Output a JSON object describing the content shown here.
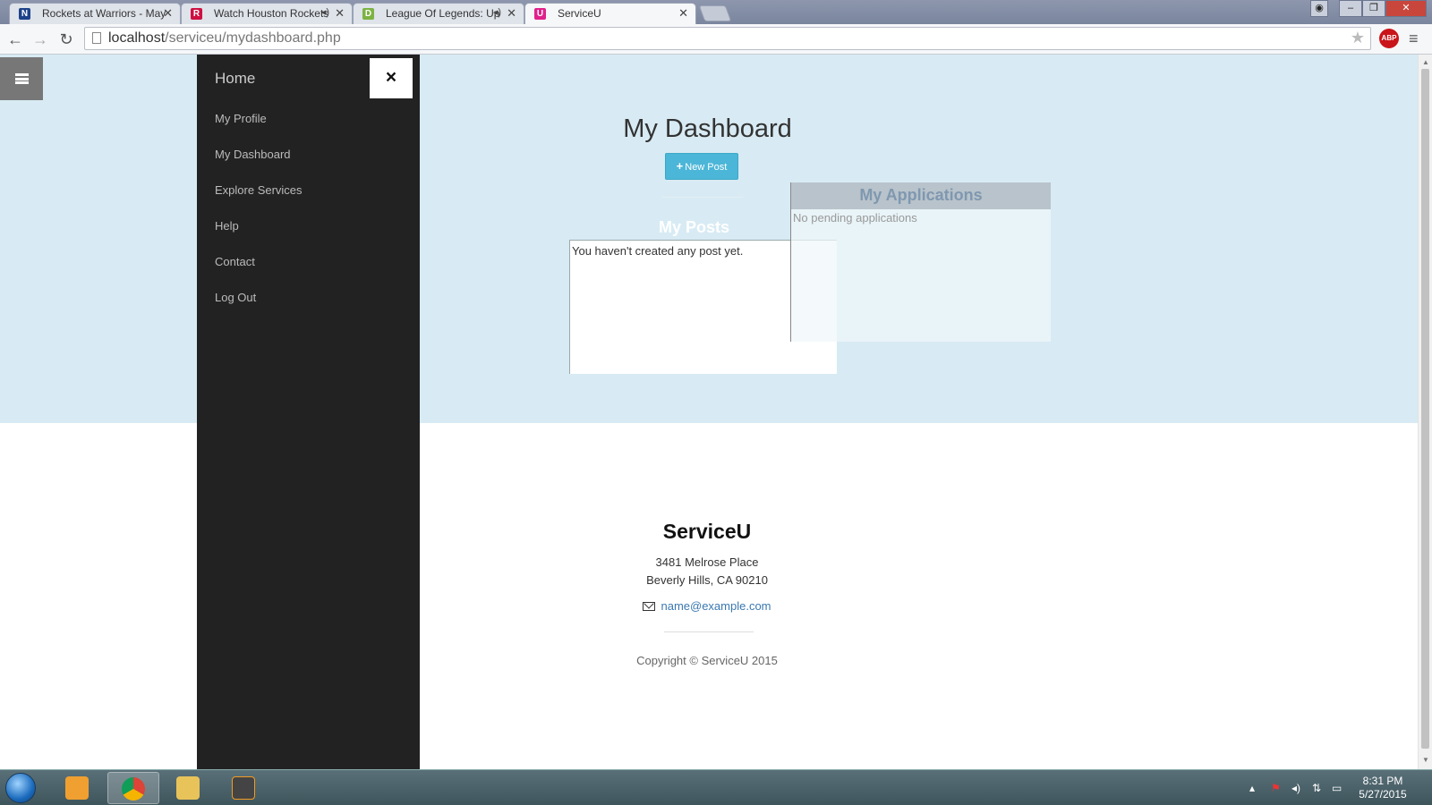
{
  "browser": {
    "tabs": [
      {
        "title": "Rockets at Warriors - May",
        "favicon": "nba-logo"
      },
      {
        "title": "Watch Houston Rockets",
        "favicon": "rocket-logo"
      },
      {
        "title": "League Of Legends: Up",
        "favicon": "letter-d-logo"
      },
      {
        "title": "ServiceU",
        "favicon": "serviceu-logo"
      }
    ],
    "url_host": "localhost",
    "url_path": "/serviceu/mydashboard.php",
    "extension_label": "ABP"
  },
  "sidebar": {
    "brand": "Home",
    "close_icon": "×",
    "items": [
      {
        "label": "My Profile"
      },
      {
        "label": "My Dashboard"
      },
      {
        "label": "Explore Services"
      },
      {
        "label": "Help"
      },
      {
        "label": "Contact"
      },
      {
        "label": "Log Out"
      }
    ]
  },
  "main": {
    "title": "My Dashboard",
    "new_post_label": "New Post",
    "posts": {
      "title": "My Posts",
      "empty_message": "You haven't created any post yet."
    },
    "applications": {
      "title": "My Applications",
      "empty_message": "No pending applications"
    }
  },
  "footer": {
    "brand": "ServiceU",
    "address_line1": "3481 Melrose Place",
    "address_line2": "Beverly Hills, CA 90210",
    "email": "name@example.com",
    "copyright": "Copyright © ServiceU 2015"
  },
  "taskbar": {
    "time": "8:31 PM",
    "date": "5/27/2015"
  },
  "colors": {
    "hero_bg": "#d8ebf4",
    "sidebar_bg": "#222222",
    "button_primary": "#4cb6d8",
    "link": "#3a78b0"
  }
}
